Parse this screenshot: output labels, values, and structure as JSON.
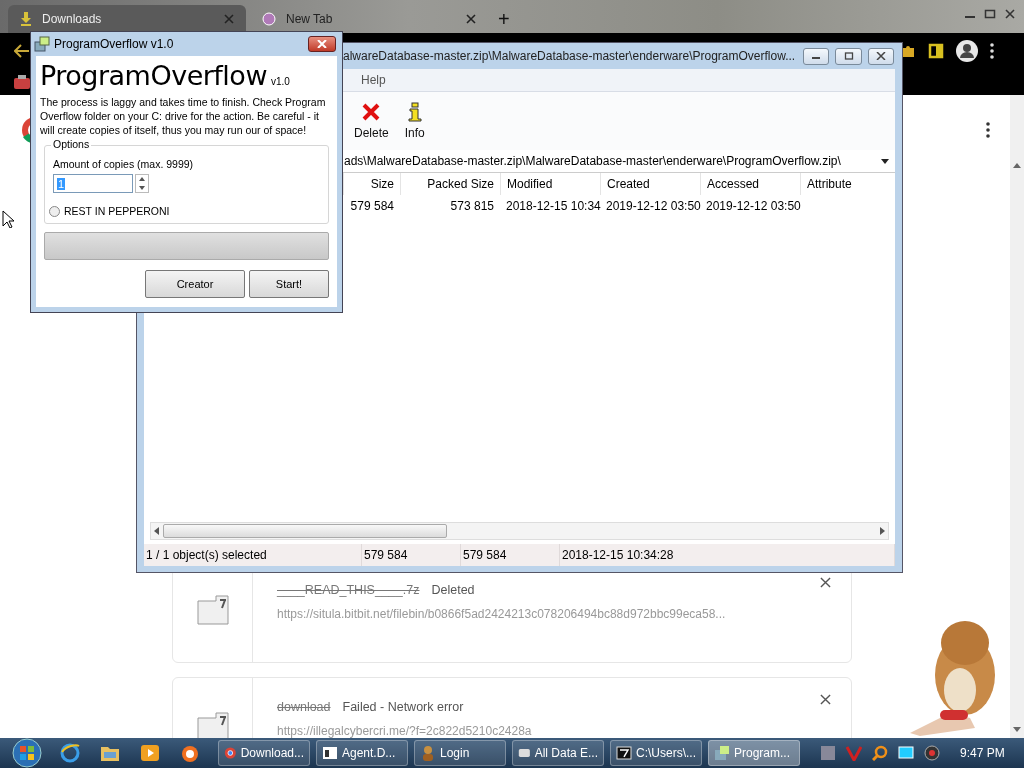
{
  "browser": {
    "tabs": [
      {
        "title": "Downloads",
        "selected": true
      },
      {
        "title": "New Tab",
        "selected": false
      }
    ],
    "new_tab_button": "+"
  },
  "downloads": [
    {
      "file_name": "____READ_THIS____.7z",
      "status": "Deleted",
      "url": "https://situla.bitbit.net/filebin/b0866f5ad2424213c078206494bc88d972bbc99eca58...",
      "struck": true
    },
    {
      "file_name": "download",
      "status": "Failed - Network error",
      "url": "https://illegalcybercri.me/?f=2c822d5210c2428a",
      "struck": true
    }
  ],
  "archive_window": {
    "title": "alwareDatabase-master.zip\\MalwareDatabase-master\\enderware\\ProgramOverflow...",
    "menu": [
      "Help"
    ],
    "toolbar": [
      {
        "label": "Delete",
        "kind": "delete"
      },
      {
        "label": "Info",
        "kind": "info"
      }
    ],
    "path": "ads\\MalwareDatabase-master.zip\\MalwareDatabase-master\\enderware\\ProgramOverflow.zip\\",
    "columns": [
      "Size",
      "Packed Size",
      "Modified",
      "Created",
      "Accessed",
      "Attribute"
    ],
    "rows": [
      {
        "cells": [
          "579 584",
          "573 815",
          "2018-12-15 10:34",
          "2019-12-12 03:50",
          "2019-12-12 03:50"
        ]
      }
    ],
    "status_bar": [
      "1 / 1 object(s) selected",
      "579 584",
      "579 584",
      "2018-12-15 10:34:28"
    ]
  },
  "dialog": {
    "title": "ProgramOverflow v1.0",
    "heading": "ProgramOverflow",
    "version": "v1.0",
    "description": "The process is laggy and takes time to finish. Check Program Overflow folder on your C: drive for the action. Be careful - it will create copies of itself, thus you may run our of space!",
    "options_label": "Options",
    "copies_label": "Amount of copies (max. 9999)",
    "copies_value": "1",
    "radio": {
      "label": "REST IN PEPPERONI",
      "checked": false
    },
    "progress": {
      "level": 0
    },
    "buttons": [
      "Creator",
      "Start!"
    ]
  },
  "taskbar": {
    "buttons": [
      {
        "label": "Download...",
        "kind": "chrome",
        "selected": false
      },
      {
        "label": "Agent.D...",
        "kind": "app",
        "selected": false
      },
      {
        "label": "Login",
        "kind": "person",
        "selected": false
      },
      {
        "label": "All Data E...",
        "kind": "disk",
        "selected": false
      },
      {
        "label": "C:\\Users\\...",
        "kind": "sevenzip",
        "selected": false
      },
      {
        "label": "Program...",
        "kind": "setup",
        "selected": true
      }
    ],
    "clock": "9:47 PM"
  }
}
